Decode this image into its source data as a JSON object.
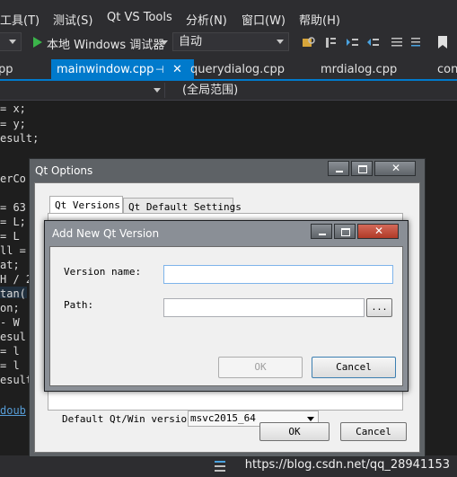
{
  "menubar": {
    "items": [
      {
        "label": "工具(T)"
      },
      {
        "label": "测试(S)"
      },
      {
        "label": "Qt VS Tools"
      },
      {
        "label": "分析(N)"
      },
      {
        "label": "窗口(W)"
      },
      {
        "label": "帮助(H)"
      }
    ]
  },
  "toolbar": {
    "debugger_label": "本地 Windows 调试器",
    "config_value": "自动"
  },
  "tabs": [
    {
      "label": "pp"
    },
    {
      "label": "mainwindow.cpp",
      "active": true
    },
    {
      "label": "querydialog.cpp"
    },
    {
      "label": "mrdialog.cpp"
    },
    {
      "label": "con"
    }
  ],
  "navbar": {
    "scope": "(全局范围)"
  },
  "code_lines": [
    "= x;",
    "= y;",
    "esult;",
    "",
    "erCo",
    "",
    "= 63",
    "= L;",
    "= L",
    "ll =",
    "at;",
    "H / 2",
    "tan(",
    "on;",
    "- W",
    "esul",
    "= l",
    "= l",
    "esult",
    "",
    "doub"
  ],
  "qt_options": {
    "title": "Qt Options",
    "tabs": {
      "versions": "Qt Versions",
      "defaults": "Qt Default Settings"
    },
    "default_version_label": "Default Qt/Win version:",
    "default_version_value": "msvc2015_64",
    "ok_button": "OK",
    "cancel_button": "Cancel"
  },
  "add_dialog": {
    "title": "Add New Qt Version",
    "version_name_label": "Version name:",
    "version_name_value": "",
    "path_label": "Path:",
    "path_value": "",
    "browse_button": "...",
    "ok_button": "OK",
    "cancel_button": "Cancel"
  },
  "watermark": "https://blog.csdn.net/qq_28941153",
  "colors": {
    "ide_background": "#1e1e1e",
    "ide_chrome": "#2d2d30",
    "accent": "#007acc"
  }
}
